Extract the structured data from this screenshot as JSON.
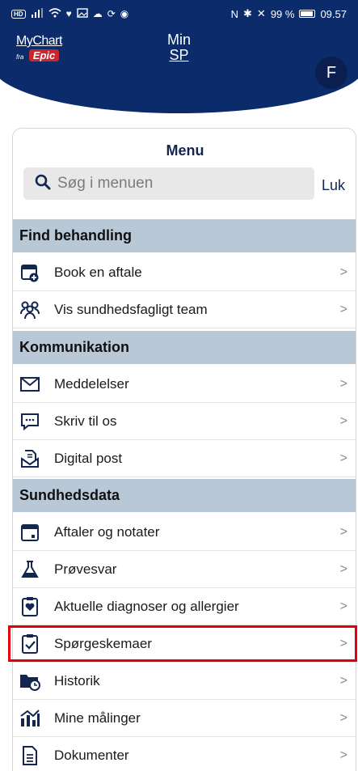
{
  "statusbar": {
    "battery": "99 %",
    "time": "09.57"
  },
  "header": {
    "logo_mychart": "MyChart",
    "logo_fra": "fra",
    "logo_epic": "Epic",
    "title_line1": "Min",
    "title_line2": "SP",
    "avatar_letter": "F",
    "color_primary": "#0b2b6b"
  },
  "menu": {
    "title": "Menu",
    "search_placeholder": "Søg i menuen",
    "close_label": "Luk",
    "sections": [
      {
        "title": "Find behandling",
        "items": [
          {
            "label": "Book en aftale",
            "icon": "calendar-plus-icon"
          },
          {
            "label": "Vis sundhedsfagligt team",
            "icon": "team-icon"
          }
        ]
      },
      {
        "title": "Kommunikation",
        "items": [
          {
            "label": "Meddelelser",
            "icon": "envelope-icon"
          },
          {
            "label": "Skriv til os",
            "icon": "chat-bubble-icon"
          },
          {
            "label": "Digital post",
            "icon": "digital-post-icon"
          }
        ]
      },
      {
        "title": "Sundhedsdata",
        "items": [
          {
            "label": "Aftaler og notater",
            "icon": "calendar-icon"
          },
          {
            "label": "Prøvesvar",
            "icon": "flask-icon"
          },
          {
            "label": "Aktuelle diagnoser og allergier",
            "icon": "heart-clipboard-icon"
          },
          {
            "label": "Spørgeskemaer",
            "icon": "checklist-icon"
          },
          {
            "label": "Historik",
            "icon": "folder-clock-icon"
          },
          {
            "label": "Mine målinger",
            "icon": "chart-bars-icon"
          },
          {
            "label": "Dokumenter",
            "icon": "document-icon"
          }
        ]
      }
    ],
    "highlight_color": "#e0000a"
  }
}
